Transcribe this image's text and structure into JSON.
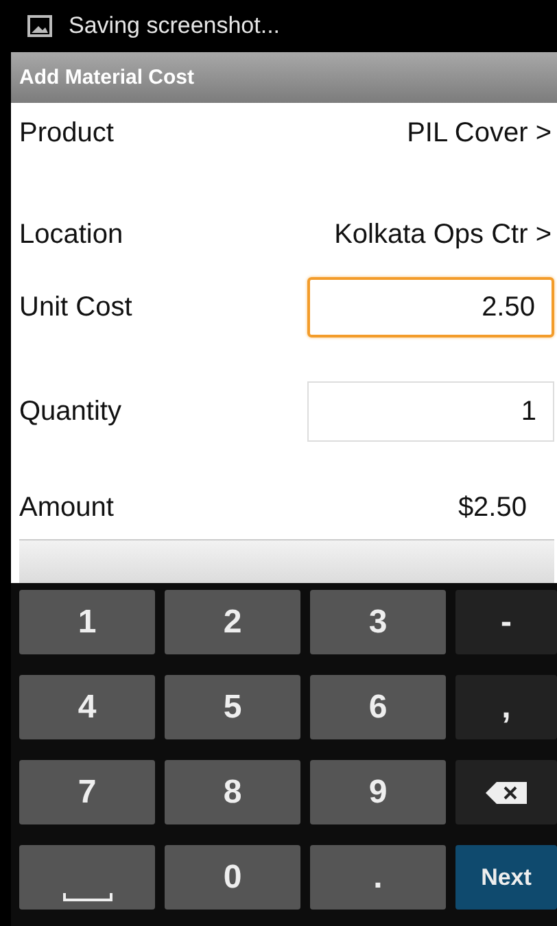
{
  "status_bar": {
    "notification": "Saving screenshot..."
  },
  "title_bar": {
    "title": "Add Material Cost"
  },
  "fields": [
    {
      "kind": "link",
      "label": "Product",
      "value": "PIL Cover >"
    },
    {
      "kind": "link",
      "label": "Location",
      "value": "Kolkata Ops Ctr >"
    },
    {
      "kind": "input",
      "label": "Unit Cost",
      "value": "2.50",
      "focused": true
    },
    {
      "kind": "input",
      "label": "Quantity",
      "value": "1",
      "focused": false
    },
    {
      "kind": "text",
      "label": "Amount",
      "value": "$2.50"
    }
  ],
  "keyboard": {
    "keys": [
      {
        "kind": "digit",
        "label": "1"
      },
      {
        "kind": "digit",
        "label": "2"
      },
      {
        "kind": "digit",
        "label": "3"
      },
      {
        "kind": "symbol",
        "label": "-"
      },
      {
        "kind": "digit",
        "label": "4"
      },
      {
        "kind": "digit",
        "label": "5"
      },
      {
        "kind": "digit",
        "label": "6"
      },
      {
        "kind": "symbol",
        "label": ","
      },
      {
        "kind": "digit",
        "label": "7"
      },
      {
        "kind": "digit",
        "label": "8"
      },
      {
        "kind": "digit",
        "label": "9"
      },
      {
        "kind": "delete"
      },
      {
        "kind": "space"
      },
      {
        "kind": "digit",
        "label": "0"
      },
      {
        "kind": "digit",
        "label": "."
      },
      {
        "kind": "action",
        "label": "Next"
      }
    ]
  }
}
